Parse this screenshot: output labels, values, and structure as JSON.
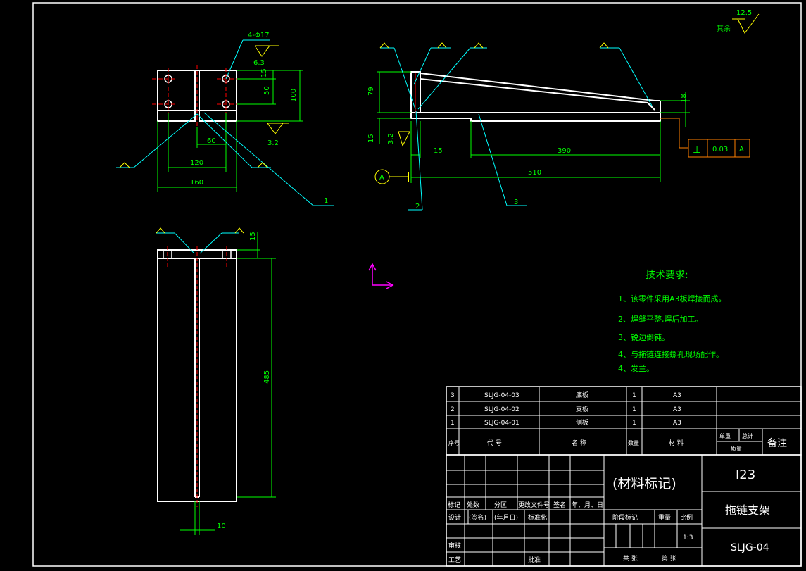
{
  "dims": {
    "top_hole": "4-Φ17",
    "top_rough": "6.3",
    "top_15": "15",
    "top_50": "50",
    "top_100": "100",
    "top_60": "60",
    "top_120": "120",
    "top_160": "160",
    "top_rough2": "3.2",
    "side_79": "79",
    "side_15v": "15",
    "side_rough": "3.2",
    "side_15": "15",
    "side_390": "390",
    "side_510": "510",
    "side_18": "18",
    "front_15": "15",
    "front_485": "485",
    "front_10": "10",
    "corner_rough": "12.5",
    "corner_rough_label": "其余"
  },
  "callouts": {
    "c1": "1",
    "c2": "2",
    "c3": "3",
    "datum": "A"
  },
  "tolerance": {
    "symbol": "⊥",
    "value": "0.03",
    "datum": "A"
  },
  "tech": {
    "title": "技术要求:",
    "items": [
      "1、该零件采用A3板焊接而成。",
      "2、焊缝平整,焊后加工。",
      "3、锐边倒钝。",
      "4、与拖链连接螺孔现场配作。",
      "4、发兰。"
    ]
  },
  "bom": {
    "rows": [
      {
        "no": "3",
        "code": "SLJG-04-03",
        "name": "底板",
        "qty": "1",
        "material": "A3"
      },
      {
        "no": "2",
        "code": "SLJG-04-02",
        "name": "支板",
        "qty": "1",
        "material": "A3"
      },
      {
        "no": "1",
        "code": "SLJG-04-01",
        "name": "侧板",
        "qty": "1",
        "material": "A3"
      }
    ],
    "hdr_no": "序号",
    "hdr_code": "代 号",
    "hdr_name": "名 称",
    "hdr_qty": "数量",
    "hdr_material": "材 料",
    "hdr_single": "单重",
    "hdr_total": "总计",
    "hdr_weight": "质量",
    "hdr_remark": "备注"
  },
  "title_block": {
    "material_mark": "(材料标记)",
    "company": "I23",
    "drawing_name": "拖链支架",
    "drawing_no": "SLJG-04",
    "scale": "1:3",
    "r_mark": "标记",
    "r_count": "处数",
    "r_zone": "分区",
    "r_change": "更改文件号",
    "r_sign": "签名",
    "r_date": "年、月、日",
    "r_design": "设计",
    "r_sign2": "(签名)",
    "r_date2": "(年月日)",
    "r_std": "标准化",
    "r_review": "审核",
    "r_craft": "工艺",
    "r_approve": "批准",
    "r_stage": "阶段标记",
    "r_weight": "重量",
    "r_ratio": "比例",
    "r_total": "共 张",
    "r_sheet": "第 张"
  },
  "colors": {
    "line": "#ffffff",
    "dim": "#00ff00",
    "leader": "#00ffff",
    "center": "#ff0000",
    "symbol": "#ffff00",
    "table": "#ffffff",
    "tolerance": "#ff8000",
    "ucs": "#ff00ff"
  }
}
